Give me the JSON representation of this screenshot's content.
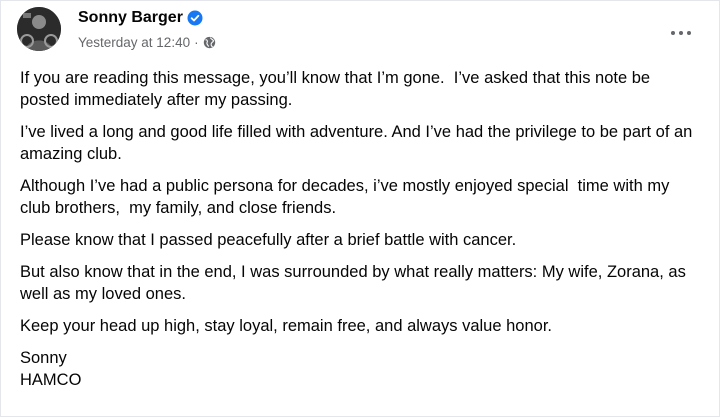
{
  "post": {
    "author": "Sonny Barger",
    "timestamp": "Yesterday at 12:40",
    "separator": "·",
    "verified_color": "#1877f2",
    "paragraphs": [
      "If you are reading this message, you’ll know that I’m gone.  I’ve asked that this note be posted immediately after my passing.",
      "I’ve lived a long and good life filled with adventure. And I’ve had the privilege to be part of an amazing club.",
      "Although I’ve had a public persona for decades, i’ve mostly enjoyed special  time with my club brothers,  my family, and close friends.",
      "Please know that I passed peacefully after a brief battle with cancer.",
      "But also know that in the end, I was surrounded by what really matters: My wife, Zorana, as well as my loved ones.",
      "Keep your head up high, stay loyal, remain free, and always value honor."
    ],
    "signature": [
      "Sonny",
      "HAMCO"
    ]
  },
  "icons": {
    "avatar": "profile-photo",
    "verified": "verified-badge-icon",
    "audience": "globe-icon",
    "menu": "more-options-icon"
  }
}
